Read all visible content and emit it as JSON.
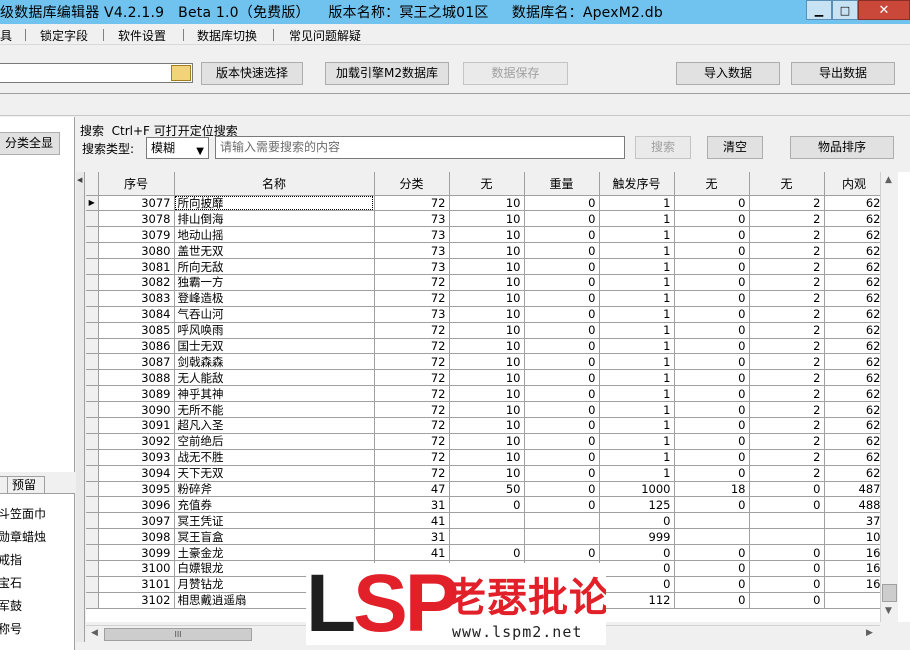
{
  "window": {
    "title": "级数据库编辑器 V4.2.1.9   Beta 1.0（免费版）    版本名称：冥王之城01区     数据库名：ApexM2.db",
    "min_glyph": "▁",
    "max_glyph": "□",
    "close_glyph": "✕"
  },
  "menu": {
    "items": [
      "具",
      "锁定字段",
      "软件设置",
      "数据库切换",
      "常见问题解疑"
    ]
  },
  "toolbar": {
    "path_value": "",
    "quick_select_label": "版本快速选择",
    "load_engine_label": "加载引擎M2数据库",
    "save_label": "数据保存",
    "import_label": "导入数据",
    "export_label": "导出数据"
  },
  "search": {
    "show_all_label": "分类全显",
    "hint": "搜索  Ctrl+F 可打开定位搜索",
    "type_label": "搜索类型:",
    "type_value": "模糊",
    "placeholder": "请输入需要搜索的内容",
    "search_button": "搜索",
    "clear_button": "清空",
    "sort_button": "物品排序"
  },
  "table": {
    "columns": [
      "序号",
      "名称",
      "分类",
      "无",
      "重量",
      "触发序号",
      "无",
      "无",
      "内观"
    ],
    "rows": [
      [
        "3077",
        "所向披靡",
        "72",
        "10",
        "0",
        "1",
        "0",
        "2",
        "62"
      ],
      [
        "3078",
        "排山倒海",
        "73",
        "10",
        "0",
        "1",
        "0",
        "2",
        "62"
      ],
      [
        "3079",
        "地动山摇",
        "73",
        "10",
        "0",
        "1",
        "0",
        "2",
        "62"
      ],
      [
        "3080",
        "盖世无双",
        "73",
        "10",
        "0",
        "1",
        "0",
        "2",
        "62"
      ],
      [
        "3081",
        "所向无敌",
        "73",
        "10",
        "0",
        "1",
        "0",
        "2",
        "62"
      ],
      [
        "3082",
        "独霸一方",
        "72",
        "10",
        "0",
        "1",
        "0",
        "2",
        "62"
      ],
      [
        "3083",
        "登峰造极",
        "72",
        "10",
        "0",
        "1",
        "0",
        "2",
        "62"
      ],
      [
        "3084",
        "气吞山河",
        "73",
        "10",
        "0",
        "1",
        "0",
        "2",
        "62"
      ],
      [
        "3085",
        "呼风唤雨",
        "72",
        "10",
        "0",
        "1",
        "0",
        "2",
        "62"
      ],
      [
        "3086",
        "国士无双",
        "72",
        "10",
        "0",
        "1",
        "0",
        "2",
        "62"
      ],
      [
        "3087",
        "剑戟森森",
        "72",
        "10",
        "0",
        "1",
        "0",
        "2",
        "62"
      ],
      [
        "3088",
        "无人能敌",
        "72",
        "10",
        "0",
        "1",
        "0",
        "2",
        "62"
      ],
      [
        "3089",
        "神乎其神",
        "72",
        "10",
        "0",
        "1",
        "0",
        "2",
        "62"
      ],
      [
        "3090",
        "无所不能",
        "72",
        "10",
        "0",
        "1",
        "0",
        "2",
        "62"
      ],
      [
        "3091",
        "超凡入圣",
        "72",
        "10",
        "0",
        "1",
        "0",
        "2",
        "62"
      ],
      [
        "3092",
        "空前绝后",
        "72",
        "10",
        "0",
        "1",
        "0",
        "2",
        "62"
      ],
      [
        "3093",
        "战无不胜",
        "72",
        "10",
        "0",
        "1",
        "0",
        "2",
        "62"
      ],
      [
        "3094",
        "天下无双",
        "72",
        "10",
        "0",
        "1",
        "0",
        "2",
        "62"
      ],
      [
        "3095",
        "粉碎斧",
        "47",
        "50",
        "0",
        "1000",
        "18",
        "0",
        "487"
      ],
      [
        "3096",
        "充值券",
        "31",
        "0",
        "0",
        "125",
        "0",
        "0",
        "488"
      ],
      [
        "3097",
        "冥王凭证",
        "41",
        "",
        "",
        "0",
        "",
        "",
        "37"
      ],
      [
        "3098",
        "冥王盲盒",
        "31",
        "",
        "",
        "999",
        "",
        "",
        "10"
      ],
      [
        "3099",
        "土豪金龙",
        "41",
        "0",
        "0",
        "0",
        "0",
        "0",
        "16"
      ],
      [
        "3100",
        "白嫖银龙",
        "",
        "",
        "",
        "0",
        "0",
        "0",
        "16"
      ],
      [
        "3101",
        "月赞钻龙",
        "",
        "",
        "",
        "0",
        "0",
        "0",
        "16"
      ],
      [
        "3102",
        "相思戴逍遥扇",
        "",
        "",
        "",
        "112",
        "0",
        "0",
        ""
      ]
    ]
  },
  "left_panel": {
    "tabs": [
      "",
      "预留"
    ],
    "items": [
      "斗笠面巾",
      "勋章蜡烛",
      "戒指",
      "宝石",
      "军鼓",
      "称号"
    ]
  },
  "watermark": {
    "logo_l": "L",
    "logo_sp": "SP",
    "cn": "老瑟批论坛",
    "url": "www.lspm2.net"
  }
}
